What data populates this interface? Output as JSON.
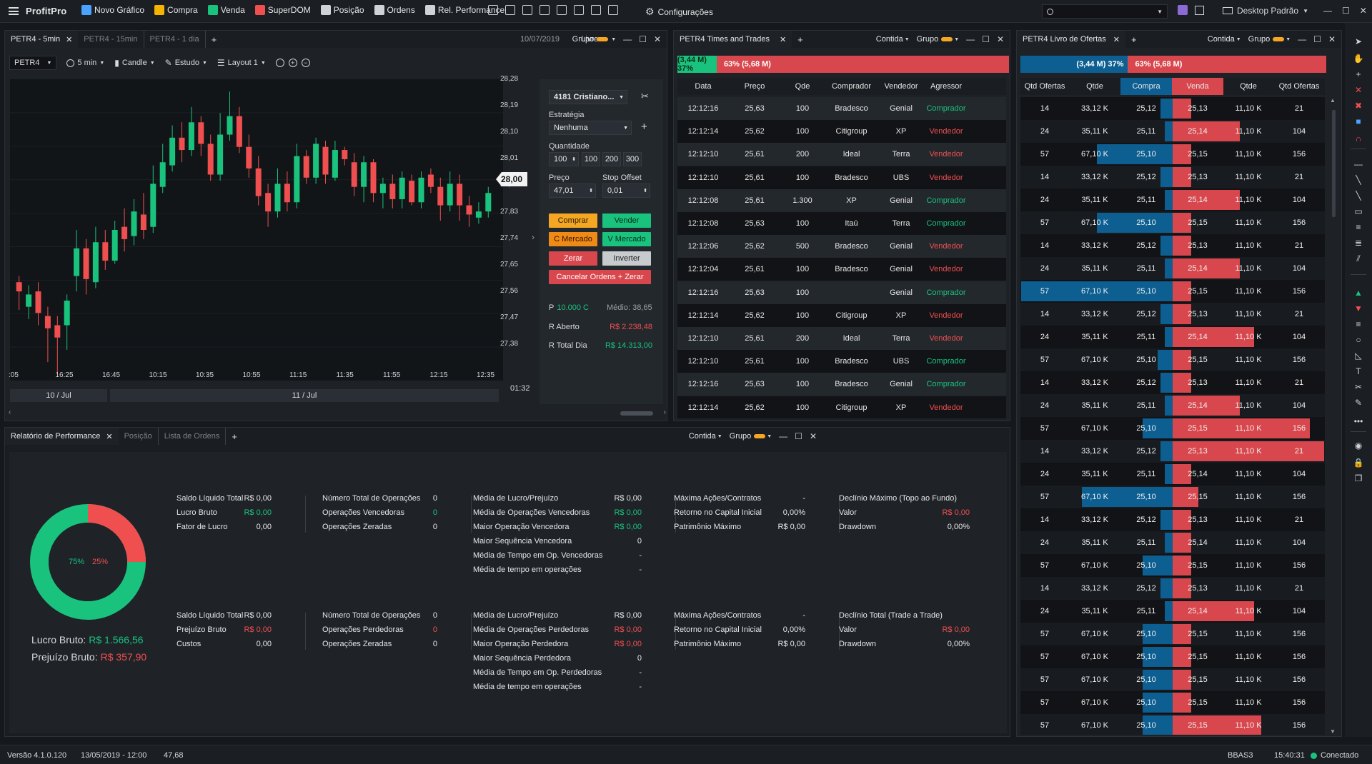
{
  "app": {
    "menu_icon": "hamburger-icon",
    "logo": "ProfitPro"
  },
  "toolbar": [
    {
      "label": "Novo Gráfico",
      "icon": "chart-add-icon",
      "color": "#4aa3ff"
    },
    {
      "label": "Compra",
      "icon": "buy-c-icon",
      "color": "#f5b400"
    },
    {
      "label": "Venda",
      "icon": "sell-v-icon",
      "color": "#19c37d"
    },
    {
      "label": "SuperDOM",
      "icon": "superdom-icon",
      "color": "#ef4f4f"
    },
    {
      "label": "Posição",
      "icon": "position-pie-icon",
      "color": "#cfd2d6"
    },
    {
      "label": "Ordens",
      "icon": "orders-list-icon",
      "color": "#cfd2d6"
    },
    {
      "label": "Rel. Performance",
      "icon": "performance-icon",
      "color": "#cfd2d6"
    }
  ],
  "toolbar_icons": [
    "replay-icon",
    "book-icon",
    "grid-icon",
    "transfer-arrows-icon",
    "calendar-icon",
    "tree-icon",
    "layers-icon",
    "table-icon"
  ],
  "config_label": "Configurações",
  "search_placeholder": "",
  "workspace": "Desktop Padrão",
  "chart_panel": {
    "tabs": [
      "PETR4 - 5min",
      "PETR4 - 15min",
      "PETR4 - 1 dia"
    ],
    "date": "10/07/2019",
    "mode": "Livre",
    "group": "Grupo",
    "ticker": "PETR4",
    "interval": "5 min",
    "style": "Candle",
    "study": "Estudo",
    "layout": "Layout 1",
    "y_ticks": [
      "28,28",
      "28,19",
      "28,10",
      "28,01",
      "27,92",
      "27,83",
      "27,74",
      "27,65",
      "27,56",
      "27,47",
      "27,38"
    ],
    "x_ticks": [
      ":05",
      "16:25",
      "16:45",
      "10:15",
      "10:35",
      "10:55",
      "11:15",
      "11:35",
      "11:55",
      "12:15",
      "12:35"
    ],
    "dates": [
      "10 / Jul",
      "11 / Jul"
    ],
    "price_tag": "28,00",
    "countdown": "01:32"
  },
  "chart_data": {
    "type": "candlestick",
    "ylim": [
      27.34,
      28.32
    ],
    "candles": [
      [
        27.66,
        27.63,
        27.68,
        27.57
      ],
      [
        27.58,
        27.62,
        27.65,
        27.54
      ],
      [
        27.63,
        27.56,
        27.66,
        27.52
      ],
      [
        27.55,
        27.51,
        27.58,
        27.4
      ],
      [
        27.52,
        27.48,
        27.55,
        27.36
      ],
      [
        27.52,
        27.6,
        27.62,
        27.44
      ],
      [
        27.68,
        27.77,
        27.83,
        27.63
      ],
      [
        27.77,
        27.67,
        27.8,
        27.62
      ],
      [
        27.66,
        27.79,
        27.84,
        27.64
      ],
      [
        27.79,
        27.73,
        27.83,
        27.7
      ],
      [
        27.73,
        27.83,
        27.86,
        27.72
      ],
      [
        27.84,
        27.8,
        27.9,
        27.76
      ],
      [
        27.81,
        27.89,
        27.93,
        27.78
      ],
      [
        27.88,
        27.83,
        27.95,
        27.8
      ],
      [
        27.84,
        27.98,
        28.04,
        27.82
      ],
      [
        27.97,
        28.05,
        28.11,
        27.95
      ],
      [
        28.04,
        28.13,
        28.17,
        28.02
      ],
      [
        28.13,
        28.09,
        28.18,
        28.05
      ],
      [
        28.09,
        28.18,
        28.23,
        28.07
      ],
      [
        28.18,
        28.11,
        28.2,
        28.07
      ],
      [
        28.11,
        28.01,
        28.14,
        27.99
      ],
      [
        28.01,
        28.14,
        28.21,
        27.99
      ],
      [
        28.14,
        28.2,
        28.28,
        28.12
      ],
      [
        28.2,
        28.1,
        28.23,
        28.08
      ],
      [
        28.1,
        28.03,
        28.14,
        28.0
      ],
      [
        28.03,
        27.94,
        28.07,
        27.91
      ],
      [
        27.95,
        27.89,
        27.98,
        27.84
      ],
      [
        27.89,
        27.98,
        28.03,
        27.87
      ],
      [
        27.98,
        27.92,
        28.02,
        27.89
      ],
      [
        27.92,
        28.07,
        28.11,
        27.9
      ],
      [
        28.07,
        28.0,
        28.09,
        27.98
      ],
      [
        28.0,
        28.11,
        28.13,
        27.98
      ],
      [
        28.1,
        28.01,
        28.12,
        27.98
      ],
      [
        28.0,
        28.09,
        28.12,
        27.99
      ],
      [
        28.09,
        28.06,
        28.1,
        28.04
      ],
      [
        28.05,
        27.97,
        28.08,
        27.94
      ],
      [
        27.97,
        28.05,
        28.07,
        27.92
      ],
      [
        28.05,
        27.95,
        28.06,
        27.92
      ],
      [
        27.95,
        27.98,
        28.0,
        27.9
      ],
      [
        27.98,
        27.93,
        28.01,
        27.9
      ],
      [
        27.93,
        28.0,
        28.02,
        27.9
      ],
      [
        27.99,
        27.92,
        28.01,
        27.91
      ],
      [
        27.92,
        28.0,
        28.02,
        27.9
      ],
      [
        28.01,
        27.97,
        28.03,
        27.95
      ],
      [
        27.97,
        27.91,
        28.0,
        27.86
      ],
      [
        27.91,
        27.98,
        28.02,
        27.89
      ],
      [
        27.98,
        27.91,
        28.01,
        27.86
      ],
      [
        27.91,
        27.88,
        27.94,
        27.84
      ],
      [
        27.87,
        27.89,
        27.92,
        27.85
      ],
      [
        27.89,
        27.95,
        27.97,
        27.87
      ]
    ]
  },
  "order_box": {
    "account": "4181 Cristiano...",
    "strategy_label": "Estratégia",
    "strategy": "Nenhuma",
    "qty_label": "Quantidade",
    "qty": "100",
    "qty_presets": [
      "100",
      "200",
      "300"
    ],
    "price_label": "Preço",
    "price": "47,01",
    "stop_label": "Stop Offset",
    "stop": "0,01",
    "buy": "Comprar",
    "sell": "Vender",
    "buy_mkt": "C Mercado",
    "sell_mkt": "V Mercado",
    "zero": "Zerar",
    "invert": "Inverter",
    "cancel": "Cancelar Ordens + Zerar",
    "pos": "P",
    "pos_val": "10.000 C",
    "avg": "Médio: 38,65",
    "open_label": "R Aberto",
    "open_val": "R$ 2.238,48",
    "day_label": "R Total Dia",
    "day_val": "R$ 14.313,00"
  },
  "times_trades": {
    "title": "PETR4 Times and Trades",
    "mode": "Contida",
    "group": "Grupo",
    "buy_bar": "(3,44 M) 37%",
    "sell_bar": "63% (5,68 M)",
    "buy_pct": 37,
    "headers": [
      "Data",
      "Preço",
      "Qde",
      "Comprador",
      "Vendedor",
      "Agressor"
    ],
    "rows": [
      [
        "12:12:16",
        "25,63",
        "100",
        "Bradesco",
        "Genial",
        "Comprador"
      ],
      [
        "12:12:14",
        "25,62",
        "100",
        "Citigroup",
        "XP",
        "Vendedor"
      ],
      [
        "12:12:10",
        "25,61",
        "200",
        "Ideal",
        "Terra",
        "Vendedor"
      ],
      [
        "12:12:10",
        "25,61",
        "100",
        "Bradesco",
        "UBS",
        "Vendedor"
      ],
      [
        "12:12:08",
        "25,61",
        "1.300",
        "XP",
        "Genial",
        "Comprador"
      ],
      [
        "12:12:08",
        "25,63",
        "100",
        "Itaú",
        "Terra",
        "Comprador"
      ],
      [
        "12:12:06",
        "25,62",
        "500",
        "Bradesco",
        "Genial",
        "Vendedor"
      ],
      [
        "12:12:04",
        "25,61",
        "100",
        "Bradesco",
        "Genial",
        "Vendedor"
      ],
      [
        "12:12:16",
        "25,63",
        "100",
        "",
        "Genial",
        "Comprador"
      ],
      [
        "12:12:14",
        "25,62",
        "100",
        "Citigroup",
        "XP",
        "Vendedor"
      ],
      [
        "12:12:10",
        "25,61",
        "200",
        "Ideal",
        "Terra",
        "Vendedor"
      ],
      [
        "12:12:10",
        "25,61",
        "100",
        "Bradesco",
        "UBS",
        "Comprador"
      ],
      [
        "12:12:16",
        "25,63",
        "100",
        "Bradesco",
        "Genial",
        "Comprador"
      ],
      [
        "12:12:14",
        "25,62",
        "100",
        "Citigroup",
        "XP",
        "Vendedor"
      ]
    ]
  },
  "book": {
    "title": "PETR4 Livro de Ofertas",
    "mode": "Contida",
    "group": "Grupo",
    "buy_bar": "(3,44 M) 37%",
    "sell_bar": "63% (5,68 M)",
    "buy_pct": 37,
    "headers": [
      "Qtd Ofertas",
      "Qtde",
      "Compra",
      "Venda",
      "Qtde",
      "Qtd Ofertas"
    ],
    "rows": [
      [
        "14",
        "33,12 K",
        "25,12",
        "25,13",
        "11,10 K",
        "21"
      ],
      [
        "24",
        "35,11 K",
        "25,11",
        "25,14",
        "11,10 K",
        "104"
      ],
      [
        "57",
        "67,10 K",
        "25,10",
        "25,15",
        "11,10 K",
        "156"
      ],
      [
        "14",
        "33,12 K",
        "25,12",
        "25,13",
        "11,10 K",
        "21"
      ],
      [
        "24",
        "35,11 K",
        "25,11",
        "25,14",
        "11,10 K",
        "104"
      ],
      [
        "57",
        "67,10 K",
        "25,10",
        "25,15",
        "11,10 K",
        "156"
      ],
      [
        "14",
        "33,12 K",
        "25,12",
        "25,13",
        "11,10 K",
        "21"
      ],
      [
        "24",
        "35,11 K",
        "25,11",
        "25,14",
        "11,10 K",
        "104"
      ],
      [
        "57",
        "67,10 K",
        "25,10",
        "25,15",
        "11,10 K",
        "156"
      ],
      [
        "14",
        "33,12 K",
        "25,12",
        "25,13",
        "11,10 K",
        "21"
      ],
      [
        "24",
        "35,11 K",
        "25,11",
        "25,14",
        "11,10 K",
        "104"
      ],
      [
        "57",
        "67,10 K",
        "25,10",
        "25,15",
        "11,10 K",
        "156"
      ],
      [
        "14",
        "33,12 K",
        "25,12",
        "25,13",
        "11,10 K",
        "21"
      ],
      [
        "24",
        "35,11 K",
        "25,11",
        "25,14",
        "11,10 K",
        "104"
      ],
      [
        "57",
        "67,10 K",
        "25,10",
        "25,15",
        "11,10 K",
        "156"
      ],
      [
        "14",
        "33,12 K",
        "25,12",
        "25,13",
        "11,10 K",
        "21"
      ],
      [
        "24",
        "35,11 K",
        "25,11",
        "25,14",
        "11,10 K",
        "104"
      ],
      [
        "57",
        "67,10 K",
        "25,10",
        "25,15",
        "11,10 K",
        "156"
      ],
      [
        "14",
        "33,12 K",
        "25,12",
        "25,13",
        "11,10 K",
        "21"
      ],
      [
        "24",
        "35,11 K",
        "25,11",
        "25,14",
        "11,10 K",
        "104"
      ],
      [
        "57",
        "67,10 K",
        "25,10",
        "25,15",
        "11,10 K",
        "156"
      ],
      [
        "14",
        "33,12 K",
        "25,12",
        "25,13",
        "11,10 K",
        "21"
      ],
      [
        "24",
        "35,11 K",
        "25,11",
        "25,14",
        "11,10 K",
        "104"
      ],
      [
        "57",
        "67,10 K",
        "25,10",
        "25,15",
        "11,10 K",
        "156"
      ],
      [
        "57",
        "67,10 K",
        "25,10",
        "25,15",
        "11,10 K",
        "156"
      ],
      [
        "57",
        "67,10 K",
        "25,10",
        "25,15",
        "11,10 K",
        "156"
      ],
      [
        "57",
        "67,10 K",
        "25,10",
        "25,15",
        "11,10 K",
        "156"
      ],
      [
        "57",
        "67,10 K",
        "25,10",
        "25,15",
        "11,10 K",
        "156"
      ]
    ],
    "buy_depth": [
      0.08,
      0.05,
      0.5,
      0.08,
      0.05,
      0.5,
      0.08,
      0.05,
      1.0,
      0.08,
      0.05,
      0.1,
      0.08,
      0.05,
      0.2,
      0.08,
      0.05,
      0.6,
      0.08,
      0.05,
      0.2,
      0.08,
      0.05,
      0.2,
      0.2,
      0.2,
      0.2,
      0.2
    ],
    "sell_depth": [
      0.05,
      0.4,
      0.05,
      0.05,
      0.4,
      0.05,
      0.05,
      0.4,
      0.05,
      0.05,
      0.5,
      0.05,
      0.05,
      0.4,
      0.9,
      1.0,
      0.05,
      0.1,
      0.05,
      0.05,
      0.05,
      0.05,
      0.5,
      0.05,
      0.05,
      0.05,
      0.05,
      0.55
    ]
  },
  "performance": {
    "tabs": [
      "Relatório de Performance",
      "Posição",
      "Lista de Ordens"
    ],
    "mode": "Contida",
    "group": "Grupo",
    "donut": {
      "win_pct": 75,
      "loss_pct": 25,
      "win_label": "75%",
      "loss_label": "25%"
    },
    "gross_profit_label": "Lucro Bruto:",
    "gross_profit": "R$ 1.566,56",
    "gross_loss_label": "Prejuízo Bruto:",
    "gross_loss": "R$ 357,90",
    "top": [
      {
        "col": 0,
        "rows": [
          [
            "Saldo Líquido Total",
            "R$ 0,00",
            ""
          ],
          [
            "Lucro Bruto",
            "R$ 0,00",
            "g"
          ],
          [
            "Fator de Lucro",
            "0,00",
            ""
          ]
        ]
      },
      {
        "col": 1,
        "rows": [
          [
            "Número Total de Operações",
            "0",
            ""
          ],
          [
            "Operações Vencedoras",
            "0",
            "g"
          ],
          [
            "Operações Zeradas",
            "0",
            ""
          ]
        ]
      },
      {
        "col": 2,
        "rows": [
          [
            "Média de Lucro/Prejuízo",
            "R$ 0,00",
            ""
          ],
          [
            "Média de Operações Vencedoras",
            "R$ 0,00",
            "g"
          ],
          [
            "Maior Operação Vencedora",
            "R$ 0,00",
            "g"
          ],
          [
            "Maior Sequência Vencedora",
            "0",
            ""
          ],
          [
            "Média de Tempo em Op. Vencedoras",
            "-",
            ""
          ],
          [
            "Média  de tempo em operações",
            "-",
            ""
          ]
        ]
      },
      {
        "col": 3,
        "rows": [
          [
            "Máxima Ações/Contratos",
            "-",
            ""
          ],
          [
            "Retorno no Capital Inicial",
            "0,00%",
            ""
          ],
          [
            "Patrimônio Máximo",
            "R$ 0,00",
            ""
          ]
        ]
      },
      {
        "col": 4,
        "rows": [
          [
            "Declínio Máximo (Topo ao Fundo)",
            "",
            ""
          ],
          [
            "Valor",
            "R$ 0,00",
            "r"
          ],
          [
            "Drawdown",
            "0,00%",
            ""
          ]
        ]
      }
    ],
    "bottom": [
      {
        "col": 0,
        "rows": [
          [
            "Saldo Líquido Total",
            "R$ 0,00",
            ""
          ],
          [
            "Prejuízo Bruto",
            "R$ 0,00",
            "r"
          ],
          [
            "Custos",
            "0,00",
            ""
          ]
        ]
      },
      {
        "col": 1,
        "rows": [
          [
            "Número Total de Operações",
            "0",
            ""
          ],
          [
            "Operações Perdedoras",
            "0",
            "r"
          ],
          [
            "Operações Zeradas",
            "0",
            ""
          ]
        ]
      },
      {
        "col": 2,
        "rows": [
          [
            "Média de Lucro/Prejuízo",
            "R$ 0,00",
            ""
          ],
          [
            "Média de Operações Perdedoras",
            "R$ 0,00",
            "r"
          ],
          [
            "Maior Operação Perdedora",
            "R$ 0,00",
            "r"
          ],
          [
            "Maior Sequência Perdedora",
            "0",
            ""
          ],
          [
            "Média de Tempo em Op. Perdedoras",
            "-",
            ""
          ],
          [
            "Média  de tempo em operações",
            "-",
            ""
          ]
        ]
      },
      {
        "col": 3,
        "rows": [
          [
            "Máxima Ações/Contratos",
            "-",
            ""
          ],
          [
            "Retorno no Capital Inicial",
            "0,00%",
            ""
          ],
          [
            "Patrimônio Máximo",
            "R$ 0,00",
            ""
          ]
        ]
      },
      {
        "col": 4,
        "rows": [
          [
            "Declínio Total (Trade a Trade)",
            "",
            ""
          ],
          [
            "Valor",
            "R$ 0,00",
            "r"
          ],
          [
            "Drawdown",
            "0,00%",
            ""
          ]
        ]
      }
    ]
  },
  "status": {
    "version": "Versão 4.1.0.120",
    "date": "13/05/2019 - 12:00",
    "value": "47,68",
    "ticker": "BBAS3",
    "time": "15:40:31",
    "conn": "Conectado"
  },
  "colors": {
    "buy": "#19c37d",
    "sell": "#ef4f4f",
    "buy_book": "#0d5f92",
    "sell_book": "#d8474d",
    "accent": "#f5a623"
  }
}
